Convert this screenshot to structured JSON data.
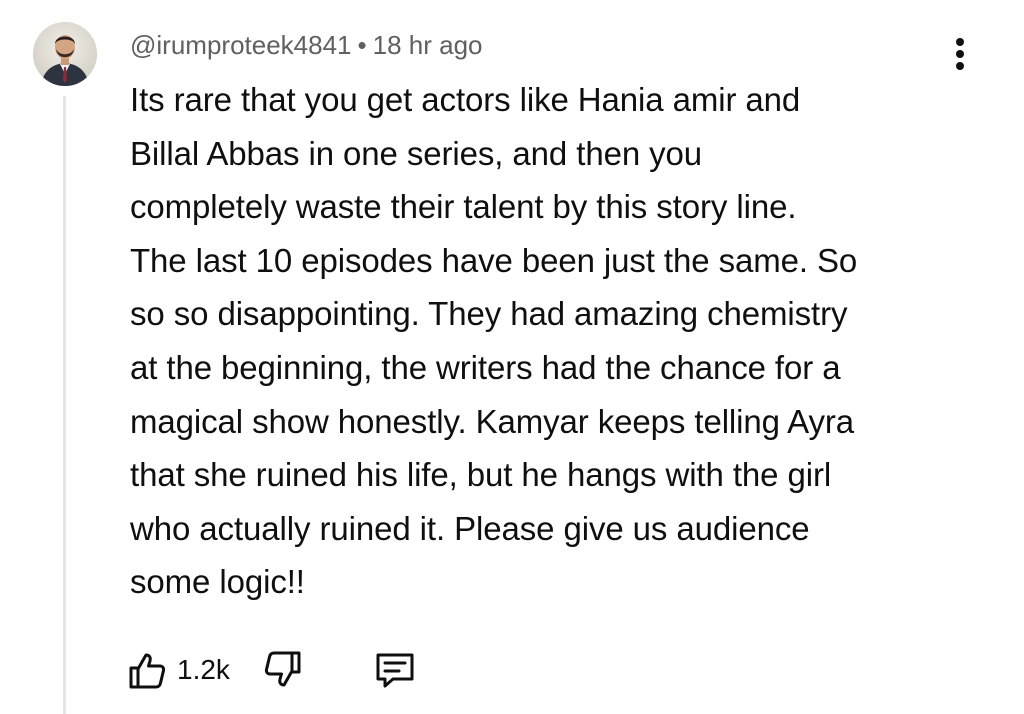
{
  "comment": {
    "author": "@irumproteek4841",
    "separator": "•",
    "time": "18 hr ago",
    "lines": [
      "Its rare that you get actors like Hania amir and",
      "Billal Abbas in one series, and then you",
      "completely waste their talent by this story line.",
      "The last 10 episodes have been just the same. So",
      "so so disappointing. They had amazing chemistry",
      "at the beginning, the writers had the chance for a",
      "magical show honestly. Kamyar keeps telling Ayra",
      "that she ruined his life, but he hangs with the girl",
      "who actually ruined it. Please give us audience",
      "some logic!!"
    ],
    "likes": "1.2k"
  },
  "icons": {
    "more": "more-vert-icon",
    "like": "thumb-up-icon",
    "dislike": "thumb-down-icon",
    "reply": "comment-reply-icon"
  },
  "colors": {
    "text": "#0f0f0f",
    "meta": "#606060",
    "thread_line": "#e5e5e5"
  }
}
